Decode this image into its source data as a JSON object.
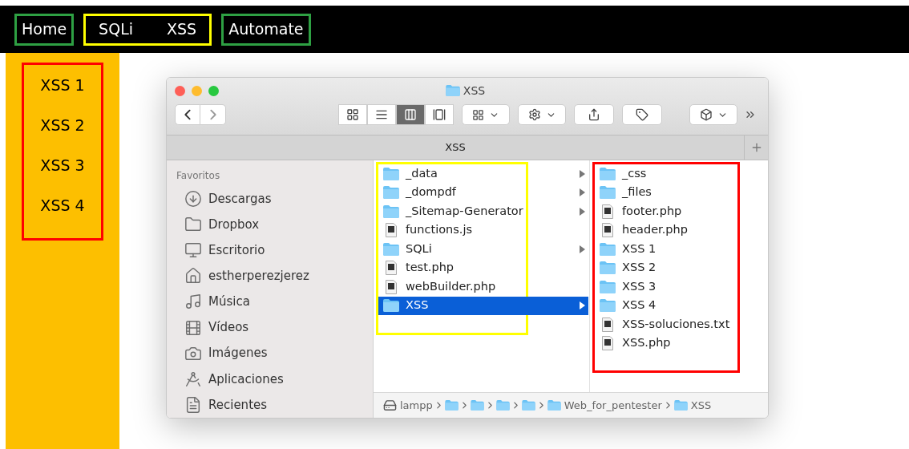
{
  "nav": {
    "groups": [
      {
        "color": "#2ea043",
        "items": [
          {
            "label": "Home"
          }
        ]
      },
      {
        "color": "#ffff00",
        "items": [
          {
            "label": "SQLi"
          },
          {
            "label": "XSS"
          }
        ]
      },
      {
        "color": "#2ea043",
        "items": [
          {
            "label": "Automate"
          }
        ]
      }
    ]
  },
  "sidebar": {
    "color": "#ff0000",
    "items": [
      {
        "label": "XSS 1"
      },
      {
        "label": "XSS 2"
      },
      {
        "label": "XSS 3"
      },
      {
        "label": "XSS 4"
      }
    ]
  },
  "finder": {
    "title": "XSS",
    "tab": "XSS",
    "view_modes": [
      {
        "kind": "icons",
        "selected": false
      },
      {
        "kind": "list",
        "selected": false
      },
      {
        "kind": "columns",
        "selected": true
      },
      {
        "kind": "gallery",
        "selected": false
      }
    ],
    "favorites_heading": "Favoritos",
    "favorites": [
      {
        "kind": "download",
        "label": "Descargas"
      },
      {
        "kind": "folder",
        "label": "Dropbox"
      },
      {
        "kind": "desktop",
        "label": "Escritorio"
      },
      {
        "kind": "home",
        "label": "estherperezjerez"
      },
      {
        "kind": "music",
        "label": "Música"
      },
      {
        "kind": "film",
        "label": "Vídeos"
      },
      {
        "kind": "camera",
        "label": "Imágenes"
      },
      {
        "kind": "apps",
        "label": "Aplicaciones"
      },
      {
        "kind": "recents",
        "label": "Recientes"
      }
    ],
    "columns": [
      {
        "color": "#ffff00",
        "items": [
          {
            "kind": "folder",
            "name": "_data",
            "has_children": true,
            "selected": false
          },
          {
            "kind": "folder",
            "name": "_dompdf",
            "has_children": true,
            "selected": false
          },
          {
            "kind": "folder",
            "name": "_Sitemap-Generator",
            "has_children": true,
            "selected": false
          },
          {
            "kind": "file",
            "name": "functions.js",
            "has_children": false,
            "selected": false
          },
          {
            "kind": "folder",
            "name": "SQLi",
            "has_children": true,
            "selected": false
          },
          {
            "kind": "file",
            "name": "test.php",
            "has_children": false,
            "selected": false
          },
          {
            "kind": "file",
            "name": "webBuilder.php",
            "has_children": false,
            "selected": false
          },
          {
            "kind": "folder",
            "name": "XSS",
            "has_children": true,
            "selected": true
          }
        ]
      },
      {
        "color": "#ff0000",
        "items": [
          {
            "kind": "folder",
            "name": "_css",
            "has_children": false,
            "selected": false
          },
          {
            "kind": "folder",
            "name": "_files",
            "has_children": false,
            "selected": false
          },
          {
            "kind": "file",
            "name": "footer.php",
            "has_children": false,
            "selected": false
          },
          {
            "kind": "file",
            "name": "header.php",
            "has_children": false,
            "selected": false
          },
          {
            "kind": "folder",
            "name": "XSS 1",
            "has_children": false,
            "selected": false
          },
          {
            "kind": "folder",
            "name": "XSS 2",
            "has_children": false,
            "selected": false
          },
          {
            "kind": "folder",
            "name": "XSS 3",
            "has_children": false,
            "selected": false
          },
          {
            "kind": "folder",
            "name": "XSS 4",
            "has_children": false,
            "selected": false
          },
          {
            "kind": "file",
            "name": "XSS-soluciones.txt",
            "has_children": false,
            "selected": false
          },
          {
            "kind": "file",
            "name": "XSS.php",
            "has_children": false,
            "selected": false
          }
        ]
      }
    ],
    "path": [
      {
        "kind": "drive",
        "label": "lampp"
      },
      {
        "kind": "folder"
      },
      {
        "kind": "folder"
      },
      {
        "kind": "folder"
      },
      {
        "kind": "folder"
      },
      {
        "kind": "folder",
        "label": "Web_for_pentester"
      },
      {
        "kind": "folder",
        "label": "XSS"
      }
    ]
  }
}
